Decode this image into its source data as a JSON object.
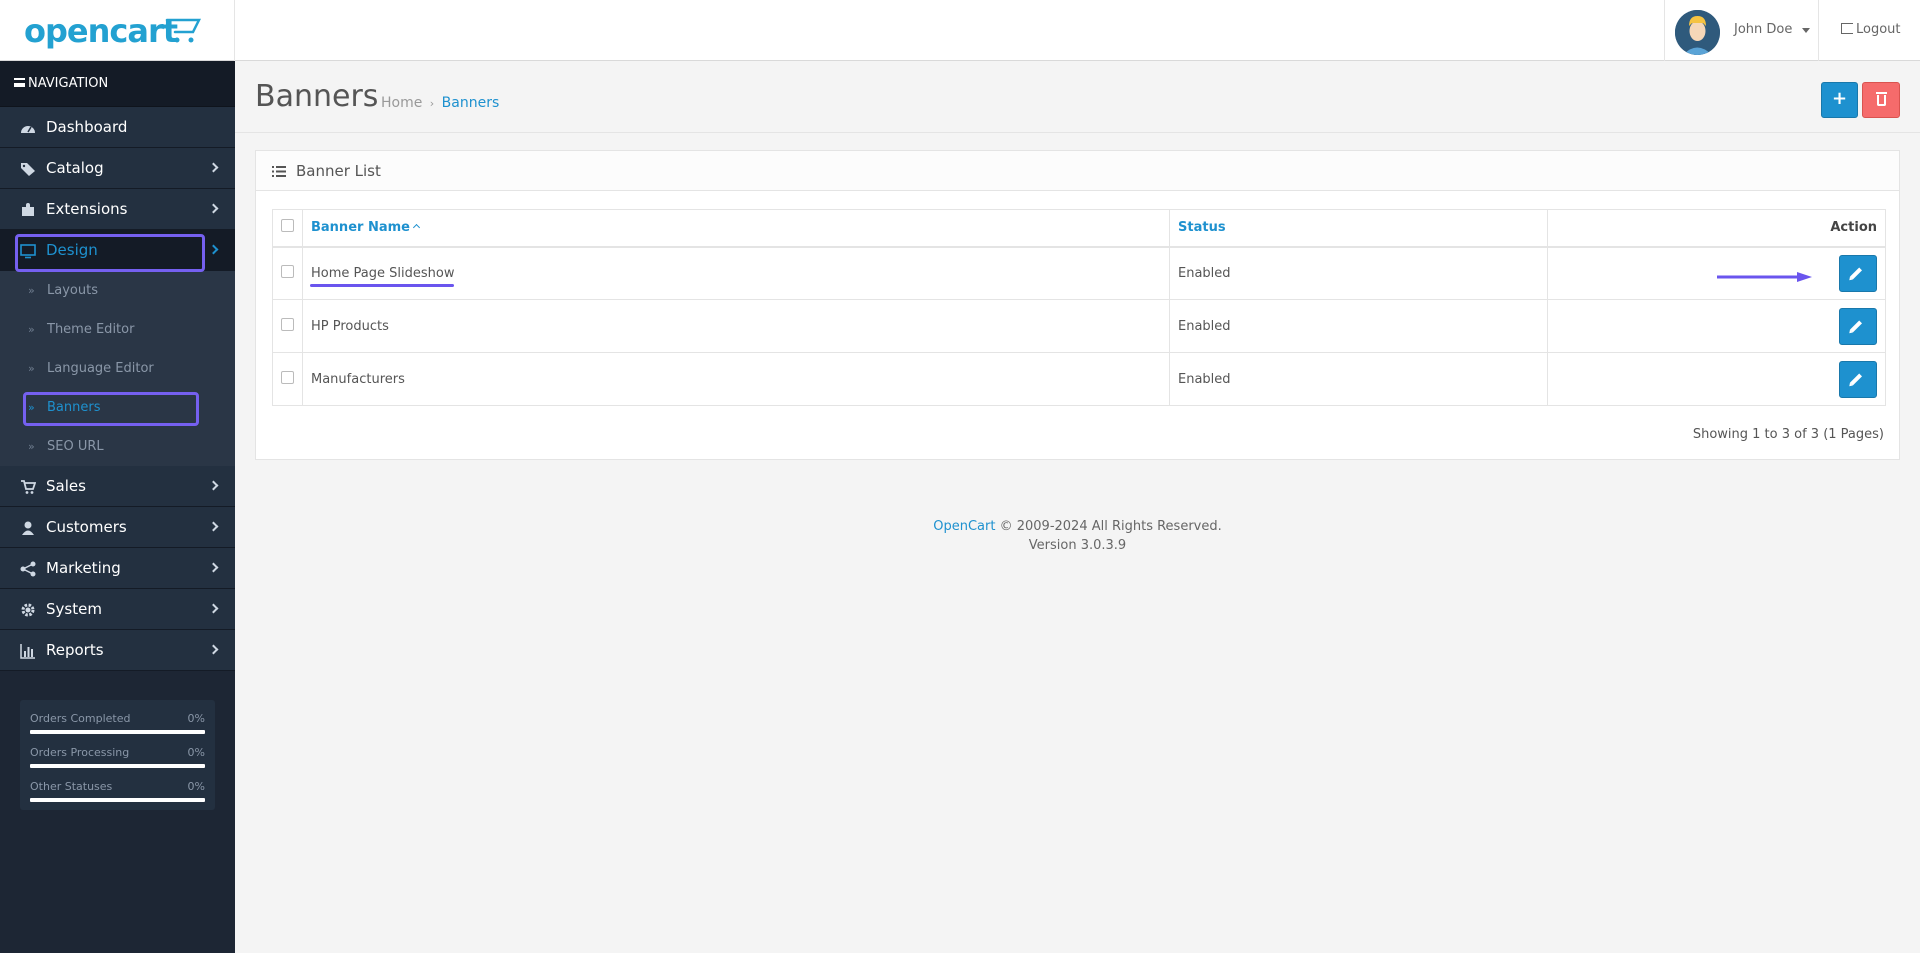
{
  "header": {
    "logo_text": "opencart",
    "user_name": "John Doe",
    "logout_label": "Logout"
  },
  "sidebar": {
    "heading": "NAVIGATION",
    "items": [
      {
        "label": "Dashboard",
        "icon": "dashboard-icon"
      },
      {
        "label": "Catalog",
        "icon": "tags-icon"
      },
      {
        "label": "Extensions",
        "icon": "puzzle-icon"
      },
      {
        "label": "Design",
        "icon": "monitor-icon",
        "active": true
      },
      {
        "label": "Sales",
        "icon": "cart-icon"
      },
      {
        "label": "Customers",
        "icon": "user-icon"
      },
      {
        "label": "Marketing",
        "icon": "share-icon"
      },
      {
        "label": "System",
        "icon": "cog-icon"
      },
      {
        "label": "Reports",
        "icon": "bar-chart-icon"
      }
    ],
    "design_submenu": [
      {
        "label": "Layouts"
      },
      {
        "label": "Theme Editor"
      },
      {
        "label": "Language Editor"
      },
      {
        "label": "Banners",
        "active": true
      },
      {
        "label": "SEO URL"
      }
    ],
    "stats": [
      {
        "label": "Orders Completed",
        "value": "0%",
        "fraction": 0
      },
      {
        "label": "Orders Processing",
        "value": "0%",
        "fraction": 0
      },
      {
        "label": "Other Statuses",
        "value": "0%",
        "fraction": 0
      }
    ]
  },
  "page": {
    "title": "Banners",
    "breadcrumb": [
      {
        "label": "Home"
      },
      {
        "label": "Banners"
      }
    ],
    "add_button_label": "+"
  },
  "panel": {
    "title": "Banner List",
    "columns": {
      "name": "Banner Name",
      "status": "Status",
      "action": "Action"
    },
    "rows": [
      {
        "name": "Home Page Slideshow",
        "status": "Enabled"
      },
      {
        "name": "HP Products",
        "status": "Enabled"
      },
      {
        "name": "Manufacturers",
        "status": "Enabled"
      }
    ],
    "pagination": "Showing 1 to 3 of 3 (1 Pages)"
  },
  "footer": {
    "brand": "OpenCart",
    "copyright": " © 2009-2024 All Rights Reserved.",
    "version": "Version 3.0.3.9"
  },
  "colors": {
    "accent": "#1e91cf",
    "danger": "#f56b6b",
    "sidebar_bg": "#1d2634",
    "annotation": "#7560f0"
  }
}
